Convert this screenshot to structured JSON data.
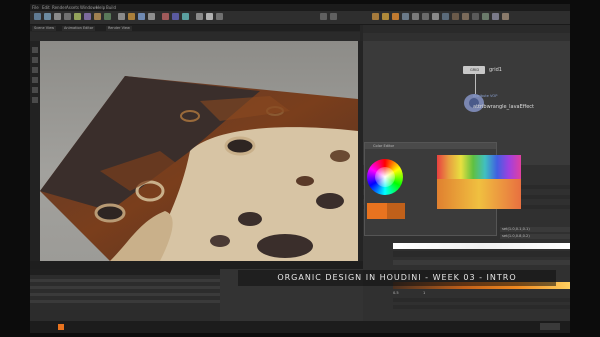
{
  "caption": {
    "text": "ORGANIC DESIGN IN HOUDINI - WEEK 03 - INTRO"
  },
  "menu": [
    "File",
    "Edit",
    "Render",
    "Assets",
    "Windows",
    "Help",
    "Build"
  ],
  "viewport_tabs": [
    "Scene View",
    "Animation Editor",
    "Render View"
  ],
  "network": {
    "node_grid": {
      "label": "grid1",
      "tag": "GRID"
    },
    "node_effect": {
      "label": "attribwrangle_lavaEffect",
      "tag": "Attribute VOP"
    }
  },
  "color_editor": {
    "title": "Color Editor"
  },
  "params": {
    "fields": [
      "set(1.0,0.1,0.1)",
      "set(1.0,0.8,0.2)"
    ],
    "values": [
      "0.5",
      "1"
    ]
  },
  "colors": {
    "accent": "#e8731f",
    "lava_light": "#d7c4a4",
    "lava_dark": "#3a2e2b",
    "rust": "#7a3e1c"
  }
}
